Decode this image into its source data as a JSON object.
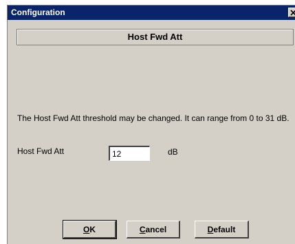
{
  "window": {
    "title": "Configuration",
    "close_symbol": "X"
  },
  "header": {
    "title": "Host Fwd Att"
  },
  "description": "The Host Fwd Att threshold may be changed.  It can range from 0 to 31 dB.",
  "field": {
    "label": "Host Fwd Att",
    "value": "12",
    "unit": "dB"
  },
  "buttons": {
    "ok": {
      "mnemonic": "O",
      "rest": "K"
    },
    "cancel": {
      "mnemonic": "C",
      "rest": "ancel"
    },
    "default": {
      "mnemonic": "D",
      "rest": "efault"
    }
  },
  "icons": {
    "close": "close-icon"
  },
  "colors": {
    "titlebar": "#0a246a",
    "dialog_bg": "#d4d0c8"
  }
}
